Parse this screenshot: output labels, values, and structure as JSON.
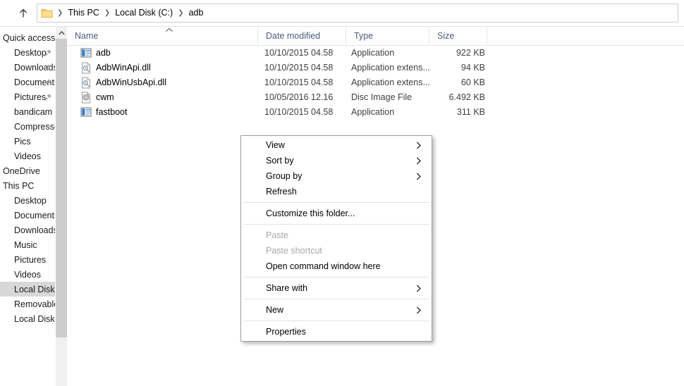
{
  "address_bar": {
    "up_button_label": "Up",
    "folder_icon": "folder-icon",
    "separator": "❯",
    "crumbs": [
      "This PC",
      "Local Disk (C:)",
      "adb"
    ]
  },
  "nav_pane": {
    "items": [
      {
        "label": "Quick access",
        "pinned": false,
        "selected": false,
        "indent": 0
      },
      {
        "label": "Desktop",
        "pinned": true,
        "selected": false,
        "indent": 1
      },
      {
        "label": "Downloads",
        "pinned": true,
        "selected": false,
        "indent": 1
      },
      {
        "label": "Documents",
        "pinned": true,
        "selected": false,
        "indent": 1
      },
      {
        "label": "Pictures",
        "pinned": true,
        "selected": false,
        "indent": 1
      },
      {
        "label": "bandicam",
        "pinned": false,
        "selected": false,
        "indent": 1
      },
      {
        "label": "Compressed",
        "pinned": false,
        "selected": false,
        "indent": 1
      },
      {
        "label": "Pics",
        "pinned": false,
        "selected": false,
        "indent": 1
      },
      {
        "label": "Videos",
        "pinned": false,
        "selected": false,
        "indent": 1
      },
      {
        "label": "OneDrive",
        "pinned": false,
        "selected": false,
        "indent": 0
      },
      {
        "label": "This PC",
        "pinned": false,
        "selected": false,
        "indent": 0
      },
      {
        "label": "Desktop",
        "pinned": false,
        "selected": false,
        "indent": 1
      },
      {
        "label": "Documents",
        "pinned": false,
        "selected": false,
        "indent": 1
      },
      {
        "label": "Downloads",
        "pinned": false,
        "selected": false,
        "indent": 1
      },
      {
        "label": "Music",
        "pinned": false,
        "selected": false,
        "indent": 1
      },
      {
        "label": "Pictures",
        "pinned": false,
        "selected": false,
        "indent": 1
      },
      {
        "label": "Videos",
        "pinned": false,
        "selected": false,
        "indent": 1
      },
      {
        "label": "Local Disk (C:)",
        "pinned": false,
        "selected": true,
        "indent": 1
      },
      {
        "label": "Removable Disk (D:)",
        "pinned": false,
        "selected": false,
        "indent": 1
      },
      {
        "label": "Local Disk (E:)",
        "pinned": false,
        "selected": false,
        "indent": 1
      }
    ],
    "scrollbar": {
      "up_arrow": "scroll-up-arrow"
    }
  },
  "columns": [
    {
      "label": "Name",
      "key": "name",
      "sorted": "asc"
    },
    {
      "label": "Date modified",
      "key": "date"
    },
    {
      "label": "Type",
      "key": "type"
    },
    {
      "label": "Size",
      "key": "size"
    }
  ],
  "files": [
    {
      "name": "adb",
      "date": "10/10/2015 04.58",
      "type": "Application",
      "size": "922 KB",
      "icon": "application-icon"
    },
    {
      "name": "AdbWinApi.dll",
      "date": "10/10/2015 04.58",
      "type": "Application extens...",
      "size": "94 KB",
      "icon": "dll-icon"
    },
    {
      "name": "AdbWinUsbApi.dll",
      "date": "10/10/2015 04.58",
      "type": "Application extens...",
      "size": "60 KB",
      "icon": "dll-icon"
    },
    {
      "name": "cwm",
      "date": "10/05/2016 12.16",
      "type": "Disc Image File",
      "size": "6.492 KB",
      "icon": "disc-image-icon"
    },
    {
      "name": "fastboot",
      "date": "10/10/2015 04.58",
      "type": "Application",
      "size": "311 KB",
      "icon": "application-icon"
    }
  ],
  "context_menu": {
    "items": [
      {
        "label": "View",
        "submenu": true,
        "disabled": false,
        "sep_after": false
      },
      {
        "label": "Sort by",
        "submenu": true,
        "disabled": false,
        "sep_after": false
      },
      {
        "label": "Group by",
        "submenu": true,
        "disabled": false,
        "sep_after": false
      },
      {
        "label": "Refresh",
        "submenu": false,
        "disabled": false,
        "sep_after": true
      },
      {
        "label": "Customize this folder...",
        "submenu": false,
        "disabled": false,
        "sep_after": true
      },
      {
        "label": "Paste",
        "submenu": false,
        "disabled": true,
        "sep_after": false
      },
      {
        "label": "Paste shortcut",
        "submenu": false,
        "disabled": true,
        "sep_after": false
      },
      {
        "label": "Open command window here",
        "submenu": false,
        "disabled": false,
        "sep_after": true
      },
      {
        "label": "Share with",
        "submenu": true,
        "disabled": false,
        "sep_after": true
      },
      {
        "label": "New",
        "submenu": true,
        "disabled": false,
        "sep_after": true
      },
      {
        "label": "Properties",
        "submenu": false,
        "disabled": false,
        "sep_after": false
      }
    ]
  },
  "colors": {
    "header_text": "#4a5a78",
    "selection": "#d8d8d8",
    "folder_yellow": "#ffd777",
    "disabled_text": "#a7a7a7",
    "menu_border": "#a0a0a0"
  }
}
